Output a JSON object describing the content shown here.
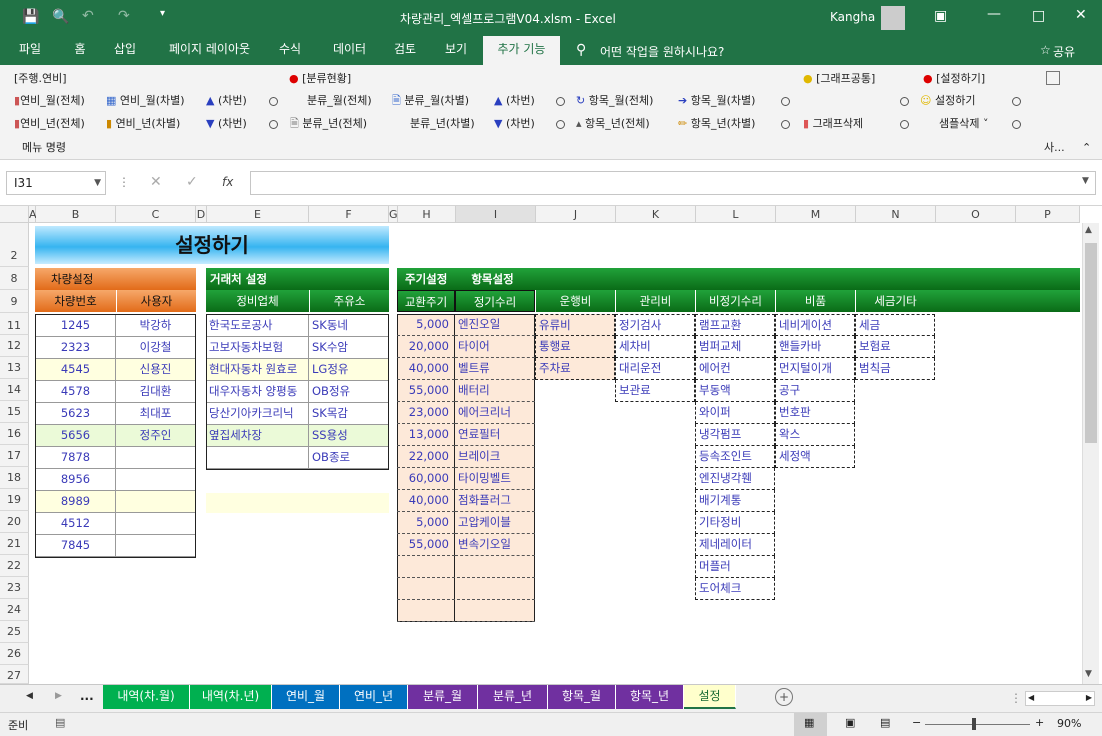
{
  "window": {
    "title": "차량관리_엑셀프로그램V04.xlsm  -  Excel",
    "user": "Kangha"
  },
  "ribbon_tabs": [
    "파일",
    "홈",
    "삽입",
    "페이지 레이아웃",
    "수식",
    "데이터",
    "검토",
    "보기",
    "추가 기능"
  ],
  "tell_me": "어떤 작업을 원하시나요?",
  "share": "공유",
  "ribbon": {
    "row0": [
      "[주행.연비]",
      "[분류현황]",
      "[그래프공통]",
      "[설정하기]"
    ],
    "row1": [
      "연비_월(전체)",
      "연비_월(차별)",
      "(차번)",
      "분류_월(전체)",
      "분류_월(차별)",
      "(차번)",
      "항목_월(전체)",
      "항목_월(차별)",
      "설정하기"
    ],
    "row2": [
      "연비_년(전체)",
      "연비_년(차별)",
      "(차번)",
      "분류_년(전체)",
      "분류_년(차별)",
      "(차번)",
      "항목_년(전체)",
      "항목_년(차별)",
      "그래프삭제",
      "샘플삭제"
    ],
    "group_label": "메뉴 명령",
    "collapsed": "사..."
  },
  "formula_bar": {
    "name_box": "I31",
    "fx": "fx",
    "value": ""
  },
  "columns": [
    "A",
    "B",
    "C",
    "D",
    "E",
    "F",
    "G",
    "H",
    "I",
    "J",
    "K",
    "L",
    "M",
    "N",
    "O",
    "P"
  ],
  "rows": [
    "2",
    "8",
    "9",
    "11",
    "12",
    "13",
    "14",
    "15",
    "16",
    "17",
    "18",
    "19",
    "20",
    "21",
    "22",
    "23",
    "24",
    "25",
    "26",
    "27"
  ],
  "sheet": {
    "title": "설정하기",
    "vehicle": {
      "section": "차량설정",
      "headers": [
        "차량번호",
        "사용자"
      ],
      "rows": [
        [
          "1245",
          "박강하"
        ],
        [
          "2323",
          "이강철"
        ],
        [
          "4545",
          "신용진"
        ],
        [
          "4578",
          "김대환"
        ],
        [
          "5623",
          "최대포"
        ],
        [
          "5656",
          "정주인"
        ],
        [
          "7878",
          ""
        ],
        [
          "8956",
          ""
        ],
        [
          "8989",
          ""
        ],
        [
          "4512",
          ""
        ],
        [
          "7845",
          ""
        ]
      ]
    },
    "vendor": {
      "section": "거래처 설정",
      "headers": [
        "정비업체",
        "주유소"
      ],
      "rows": [
        [
          "한국도로공사",
          "SK동네"
        ],
        [
          "고보자동차보험",
          "SK수암"
        ],
        [
          "현대자동차 원효로",
          "LG정유"
        ],
        [
          "대우자동차 양평동",
          "OB정유"
        ],
        [
          "당산기아카크리닉",
          "SK목감"
        ],
        [
          "옆집세차장",
          "SS용성"
        ],
        [
          "",
          "OB종로"
        ]
      ]
    },
    "items": {
      "section1": "주기설정",
      "section2": "항목설정",
      "headers": [
        "교환주기",
        "정기수리",
        "운행비",
        "관리비",
        "비정기수리",
        "비품",
        "세금기타"
      ],
      "cycle": [
        "5,000",
        "20,000",
        "40,000",
        "55,000",
        "23,000",
        "13,000",
        "22,000",
        "60,000",
        "40,000",
        "5,000",
        "55,000"
      ],
      "regular_repair": [
        "엔진오일",
        "타이어",
        "벨트류",
        "배터리",
        "에어크리너",
        "연료필터",
        "브레이크",
        "타이밍벨트",
        "점화플러그",
        "고압케이블",
        "변속기오일"
      ],
      "operating": [
        "유류비",
        "통행료",
        "주차료"
      ],
      "management": [
        "정기검사",
        "세차비",
        "대리운전",
        "보관료"
      ],
      "irregular": [
        "램프교환",
        "범퍼교체",
        "에어컨",
        "부동액",
        "와이퍼",
        "냉각펌프",
        "등속조인트",
        "엔진냉각휀",
        "배기계통",
        "기타정비",
        "제네레이터",
        "머플러",
        "도어체크"
      ],
      "supplies": [
        "네비게이션",
        "핸들카바",
        "먼지털이개",
        "공구",
        "번호판",
        "왁스",
        "세정액"
      ],
      "tax": [
        "세금",
        "보험료",
        "범칙금"
      ]
    }
  },
  "sheet_tabs": [
    {
      "label": "내역(차.월)",
      "color": "#00b050"
    },
    {
      "label": "내역(차.년)",
      "color": "#00b050"
    },
    {
      "label": "연비_월",
      "color": "#0070c0"
    },
    {
      "label": "연비_년",
      "color": "#0070c0"
    },
    {
      "label": "분류_월",
      "color": "#7030a0"
    },
    {
      "label": "분류_년",
      "color": "#7030a0"
    },
    {
      "label": "항목_월",
      "color": "#7030a0"
    },
    {
      "label": "항목_년",
      "color": "#7030a0"
    },
    {
      "label": "설정",
      "color": "#ffffcc"
    }
  ],
  "status": {
    "ready": "준비",
    "zoom": "90%"
  }
}
